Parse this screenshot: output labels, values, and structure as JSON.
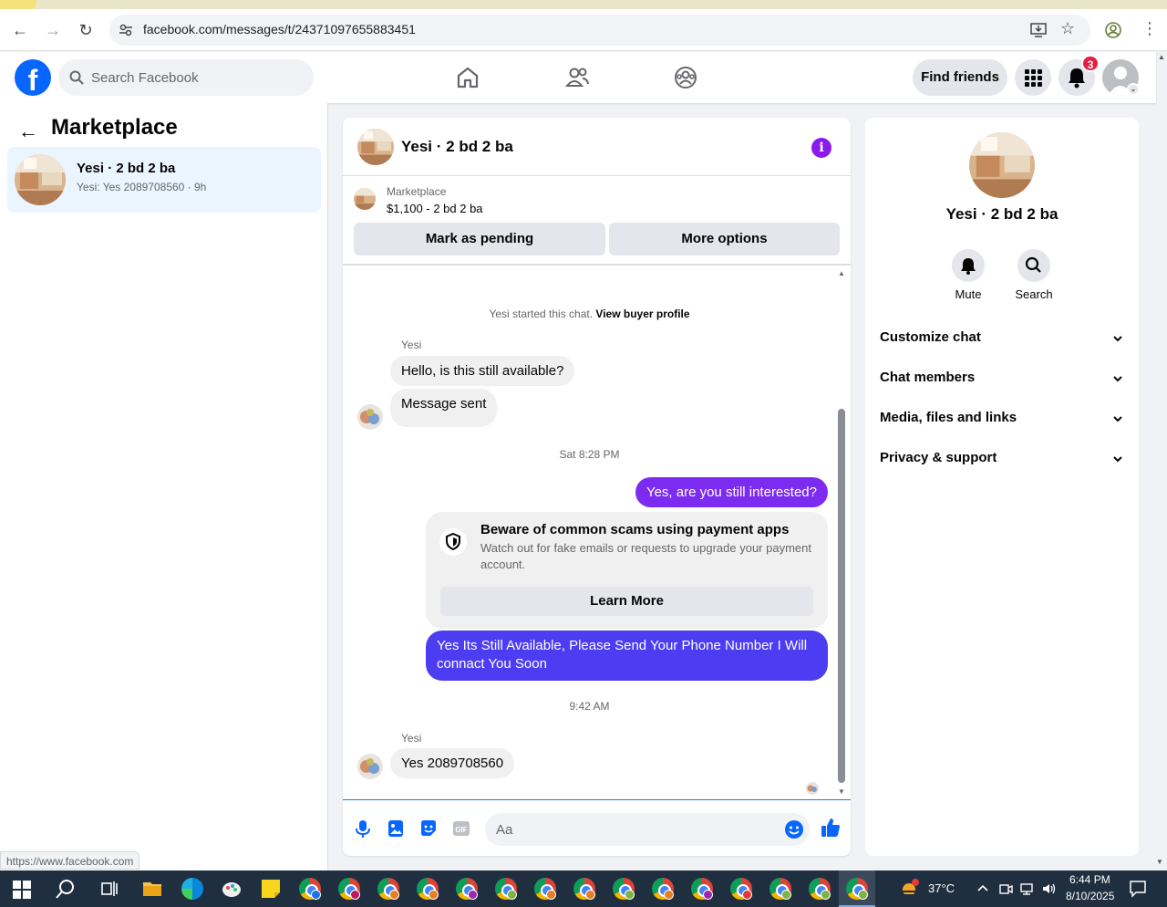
{
  "browser": {
    "url": "facebook.com/messages/t/24371097655883451",
    "status_url": "https://www.facebook.com"
  },
  "header": {
    "logo": "f",
    "search_placeholder": "Search Facebook",
    "find_friends": "Find friends",
    "notification_count": "3"
  },
  "left": {
    "back_icon": "←",
    "title": "Marketplace",
    "conversation": {
      "name": "Yesi · 2 bd 2 ba",
      "snippet": "Yesi: Yes 2089708560 · 9h"
    }
  },
  "chat": {
    "title": "Yesi · 2 bd 2 ba",
    "listing": {
      "kind": "Marketplace",
      "price_title": "$1,100 - 2 bd 2 ba",
      "btn_pending": "Mark as pending",
      "btn_more": "More options"
    },
    "started_text": "Yesi started this chat.",
    "view_profile": "View buyer profile",
    "sender": "Yesi",
    "msg1": "Hello, is this still available?",
    "msg2": "Message sent",
    "time1": "Sat 8:28 PM",
    "out1": "Yes, are you still interested?",
    "scam_title": "Beware of common scams using payment apps",
    "scam_body": "Watch out for fake emails or requests to upgrade your payment account.",
    "learn_more": "Learn More",
    "out2": "Yes Its Still Available, Please Send Your Phone Number I Will connact You Soon",
    "time2": "9:42 AM",
    "sender2": "Yesi",
    "msg3": "Yes 2089708560",
    "composer_placeholder": "Aa"
  },
  "right": {
    "name": "Yesi · 2 bd 2 ba",
    "actions": [
      {
        "label": "Mute",
        "icon": "bell-icon"
      },
      {
        "label": "Search",
        "icon": "search-icon"
      }
    ],
    "sections": [
      "Customize chat",
      "Chat members",
      "Media, files and links",
      "Privacy & support"
    ]
  },
  "taskbar": {
    "temp": "37°C",
    "time": "6:44 PM",
    "date": "8/10/2025"
  },
  "colors": {
    "fb_blue": "#0866ff",
    "out1_bubble": "#7b2cf0",
    "out2_bubble": "#4c3cf2",
    "info_purple": "#8a1be8"
  }
}
